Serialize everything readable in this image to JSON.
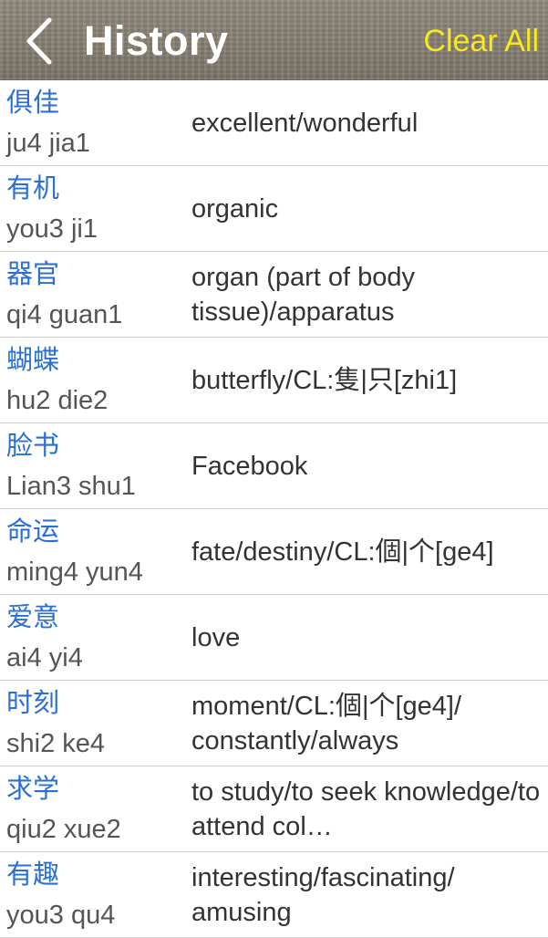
{
  "header": {
    "title": "History",
    "clear_label": "Clear All",
    "back_icon": "chevron-left-icon",
    "title_color": "#ffffff",
    "clear_color": "#f5ea1e"
  },
  "colors": {
    "hanzi": "#2a6fd6",
    "pinyin": "#555555",
    "definition": "#333333",
    "separator": "#cfcfcf"
  },
  "entries": [
    {
      "hanzi": "俱佳",
      "pinyin": "ju4 jia1",
      "definition": "excellent/wonderful"
    },
    {
      "hanzi": "有机",
      "pinyin": "you3 ji1",
      "definition": "organic"
    },
    {
      "hanzi": "器官",
      "pinyin": "qi4 guan1",
      "definition": "organ (part of body tissue)/apparatus"
    },
    {
      "hanzi": "蝴蝶",
      "pinyin": "hu2 die2",
      "definition": "butterfly/CL:隻|只[zhi1]"
    },
    {
      "hanzi": "脸书",
      "pinyin": "Lian3 shu1",
      "definition": "Facebook"
    },
    {
      "hanzi": "命运",
      "pinyin": "ming4 yun4",
      "definition": "fate/destiny/CL:個|个[ge4]"
    },
    {
      "hanzi": "爱意",
      "pinyin": "ai4 yi4",
      "definition": "love"
    },
    {
      "hanzi": "时刻",
      "pinyin": "shi2 ke4",
      "definition": "moment/CL:個|个[ge4]/ constantly/always"
    },
    {
      "hanzi": "求学",
      "pinyin": "qiu2 xue2",
      "definition": "to study/to seek knowledge/to attend col…"
    },
    {
      "hanzi": "有趣",
      "pinyin": "you3 qu4",
      "definition": "interesting/fascinating/ amusing"
    }
  ]
}
